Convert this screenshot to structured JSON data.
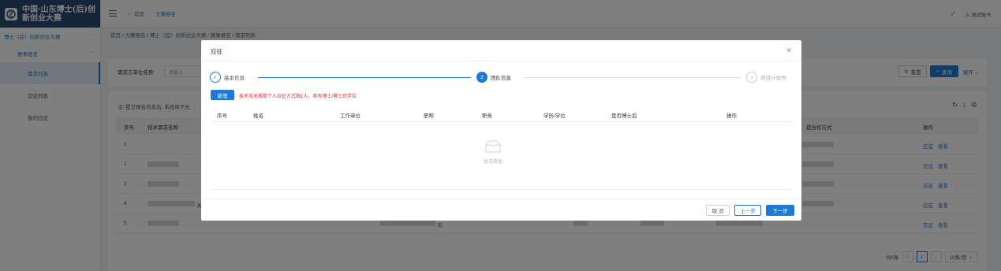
{
  "app": {
    "logo_line1": "中国·山东博士(后)创",
    "logo_line2": "新创业大赛"
  },
  "sidebar": {
    "group_label": "博士（后）创新创业大赛",
    "sub_label": "赛事报名",
    "items": [
      {
        "label": "需求列表",
        "active": true
      },
      {
        "label": "应征列表",
        "active": false
      },
      {
        "label": "我的应征",
        "active": false
      }
    ]
  },
  "header": {
    "tab_home": "首页",
    "tab_active": "大赛报名",
    "user_label": "测试账号"
  },
  "breadcrumb": "首页 / 大赛报名 / 博士（后）创新创业大赛 / 赛事报名 / 需求列表",
  "search": {
    "label": "需求方单位名称:",
    "placeholder": "请输入",
    "reset_label": "重置",
    "search_label": "查询",
    "expand_label": "展开"
  },
  "table": {
    "note": "注: 提交报名信息后, 系统将不允",
    "headers": {
      "index": "序号",
      "name": "技术需求名称",
      "contact": "提合作方式",
      "ops": "操作"
    },
    "rows": [
      {
        "index": "1",
        "extra": ""
      },
      {
        "index": "2",
        "extra": ""
      },
      {
        "index": "3",
        "extra": ""
      },
      {
        "index": "4",
        "extra": "关"
      },
      {
        "index": "5",
        "extra": "司"
      }
    ],
    "action_apply": "应征",
    "action_view": "查看",
    "pager": {
      "total": "共5条",
      "current": "1",
      "size": "10条/页"
    }
  },
  "modal": {
    "title": "应征",
    "steps": [
      {
        "num": "✓",
        "label": "基本信息",
        "state": "done"
      },
      {
        "num": "2",
        "label": "团队信息",
        "state": "current"
      },
      {
        "num": "3",
        "label": "项目计划书",
        "state": "todo"
      }
    ],
    "add_label": "新增",
    "warning": "技术攻关揭单个人应征方式限1人，具有博士/博士后学位",
    "headers": [
      "序号",
      "姓名",
      "工作单位",
      "职称",
      "职务",
      "学历/学位",
      "是否博士后",
      "操作"
    ],
    "empty_text": "暂无数据",
    "cancel_label": "取 消",
    "prev_label": "上一步",
    "next_label": "下一步"
  }
}
